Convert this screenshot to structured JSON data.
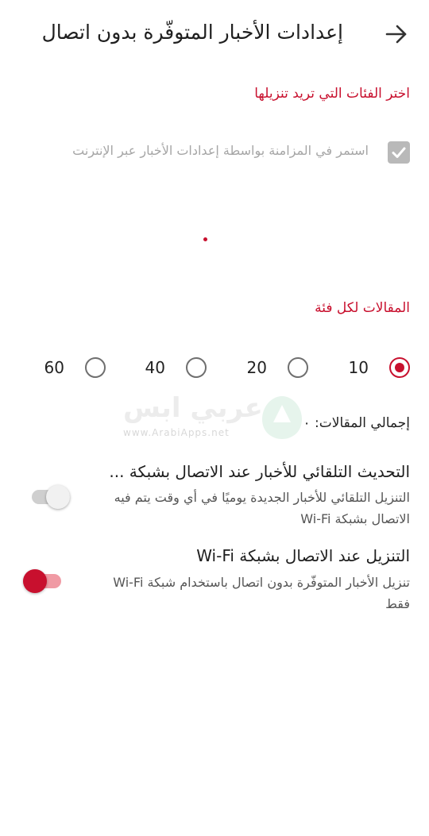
{
  "header": {
    "title": "إعدادات الأخبار المتوفّرة بدون اتصال",
    "back_icon": "arrow-right-icon"
  },
  "categories_section": {
    "title": "اختر الفئات التي تريد تنزيلها",
    "sync_checkbox": {
      "label": "استمر في المزامنة بواسطة إعدادات الأخبار عبر الإنترنت",
      "checked": true
    }
  },
  "articles_section": {
    "title": "المقالات لكل فئة",
    "options": [
      {
        "label": "10",
        "selected": true
      },
      {
        "label": "20",
        "selected": false
      },
      {
        "label": "40",
        "selected": false
      },
      {
        "label": "60",
        "selected": false
      }
    ],
    "total_label": "إجمالي المقالات: ٠"
  },
  "watermark": {
    "text": "عربي ابس",
    "sub": "www.ArabiApps.net"
  },
  "auto_update": {
    "title": "التحديث التلقائي للأخبار عند الاتصال بشبكة ...",
    "description": "التنزيل التلقائي للأخبار الجديدة يوميًا في أي وقت يتم فيه الاتصال بشبكة Wi-Fi",
    "enabled": false
  },
  "wifi_download": {
    "title": "التنزيل عند الاتصال بشبكة Wi-Fi",
    "description": "تنزيل الأخبار المتوفّرة بدون اتصال باستخدام شبكة Wi-Fi فقط",
    "enabled": true
  },
  "colors": {
    "accent": "#c8102e",
    "disabled": "#b9b9b9"
  }
}
